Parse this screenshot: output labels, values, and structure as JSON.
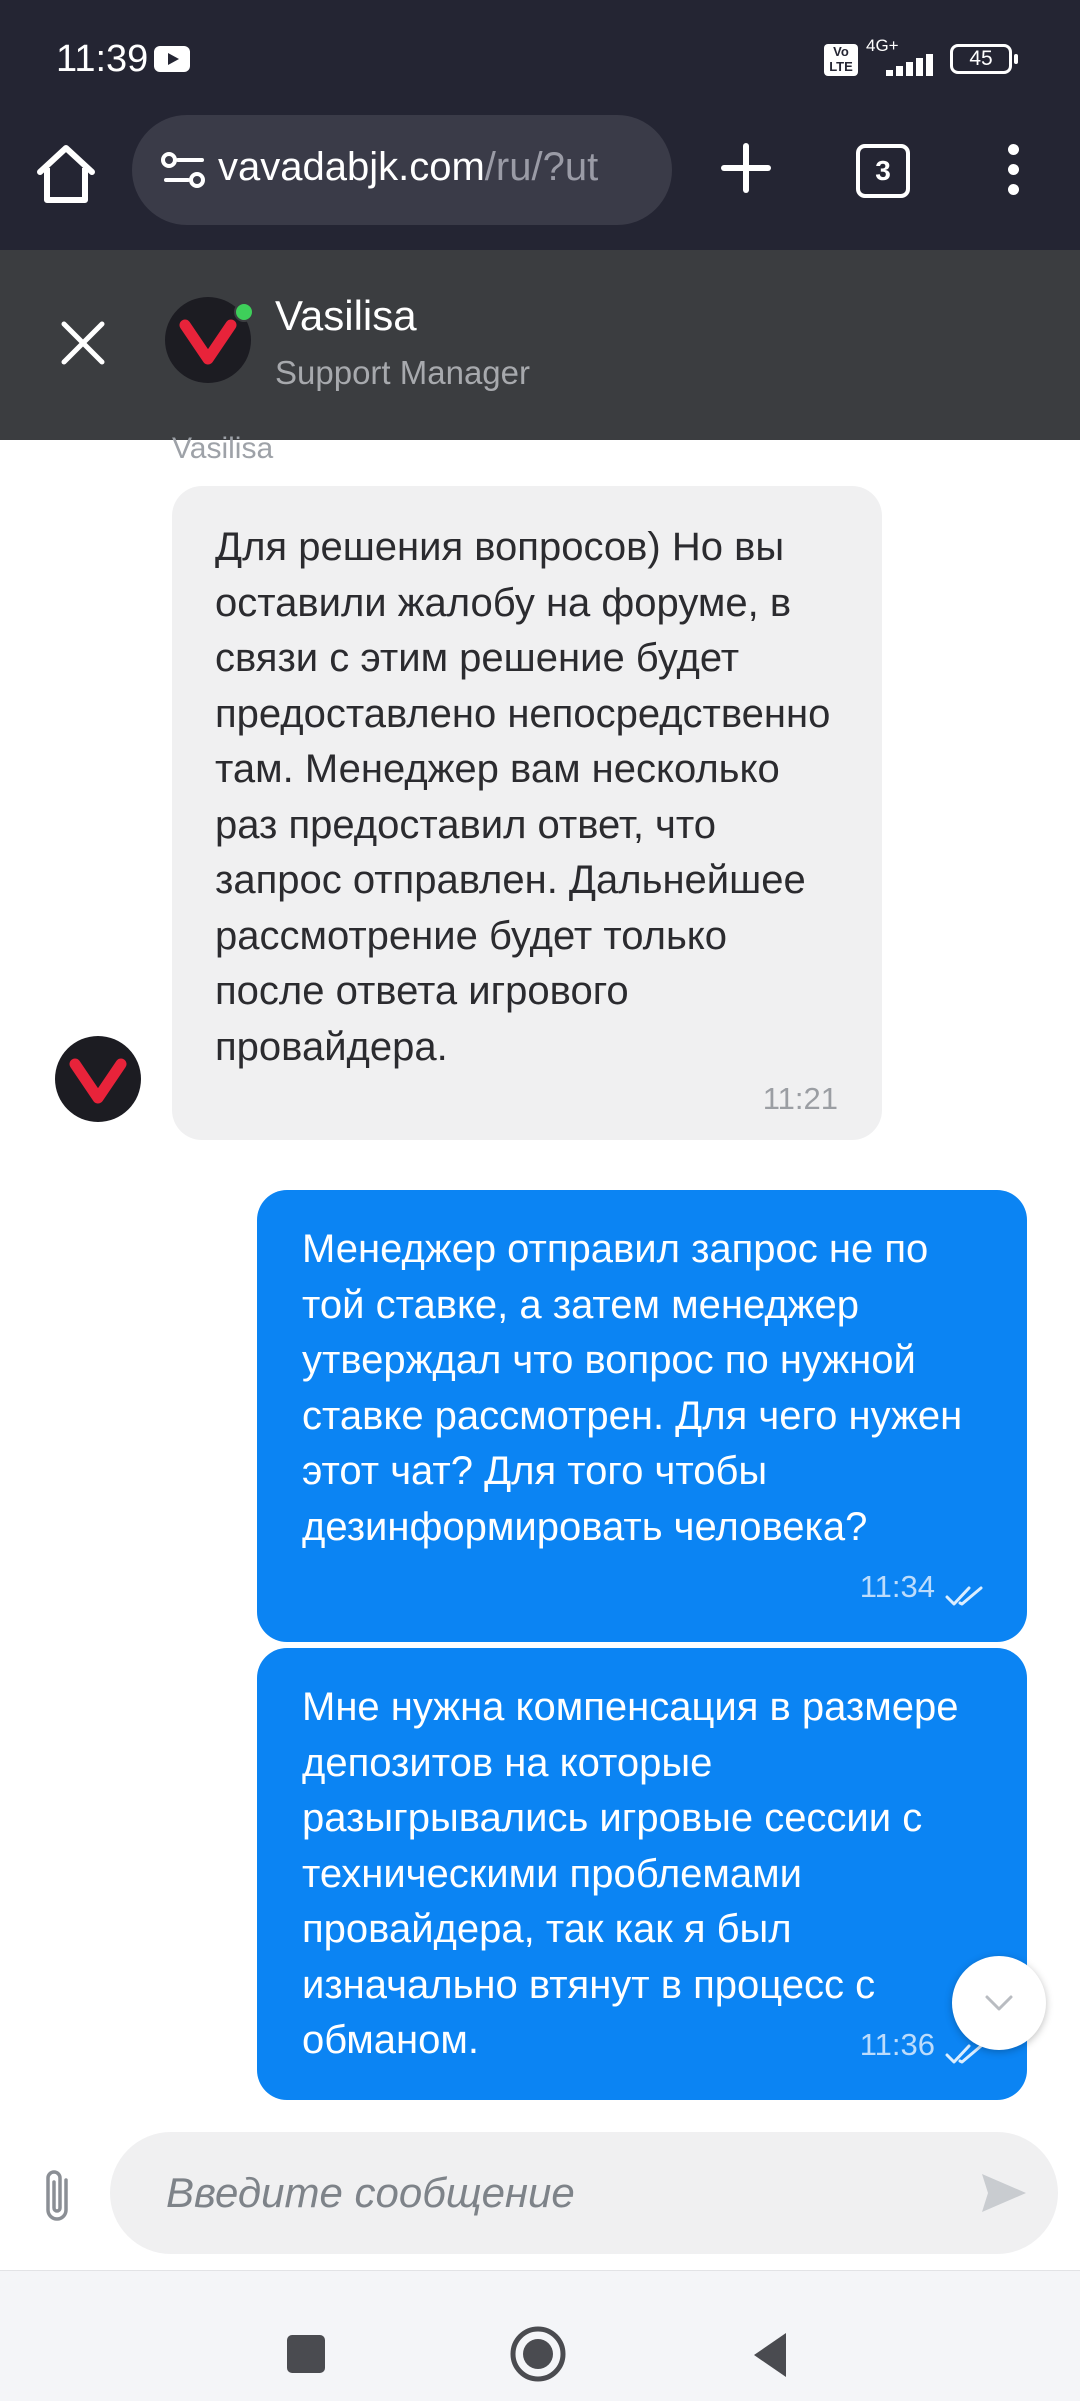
{
  "status_bar": {
    "time": "11:39",
    "volte": "Vo LTE",
    "network": "4G+",
    "battery": "45"
  },
  "browser": {
    "url_host": "vavadabjk.com",
    "url_path": "/ru/?ut",
    "tab_count": "3"
  },
  "chat_header": {
    "agent_name": "Vasilisa",
    "agent_role": "Support Manager",
    "online_color": "#3ecf5a"
  },
  "messages": [
    {
      "sender_label": "Vasilisa",
      "text": "Для решения вопросов) Но вы оставили жалобу на форуме, в связи с этим решение будет предоставлено непосредственно там. Менеджер вам несколько раз предоставил ответ, что запрос отправлен. Дальнейшее рассмотрение будет только после ответа игрового провайдера.",
      "time": "11:21"
    },
    {
      "text": "Менеджер отправил запрос не по той ставке, а затем менеджер утверждал что вопрос по нужной ставке рассмотрен. Для чего нужен этот чат? Для того чтобы дезинформировать человека?",
      "time": "11:34"
    },
    {
      "text": "Мне нужна компенсация в размере депозитов на которые разыгрывались игровые сессии с техническими проблемами провайдера, так как я был изначально втянут в процесс с обманом.",
      "time": "11:36"
    }
  ],
  "composer": {
    "placeholder": "Введите сообщение"
  },
  "colors": {
    "outgoing_bubble": "#0b84f3",
    "incoming_bubble": "#f0f0f1",
    "brand_red": "#e8233a"
  }
}
